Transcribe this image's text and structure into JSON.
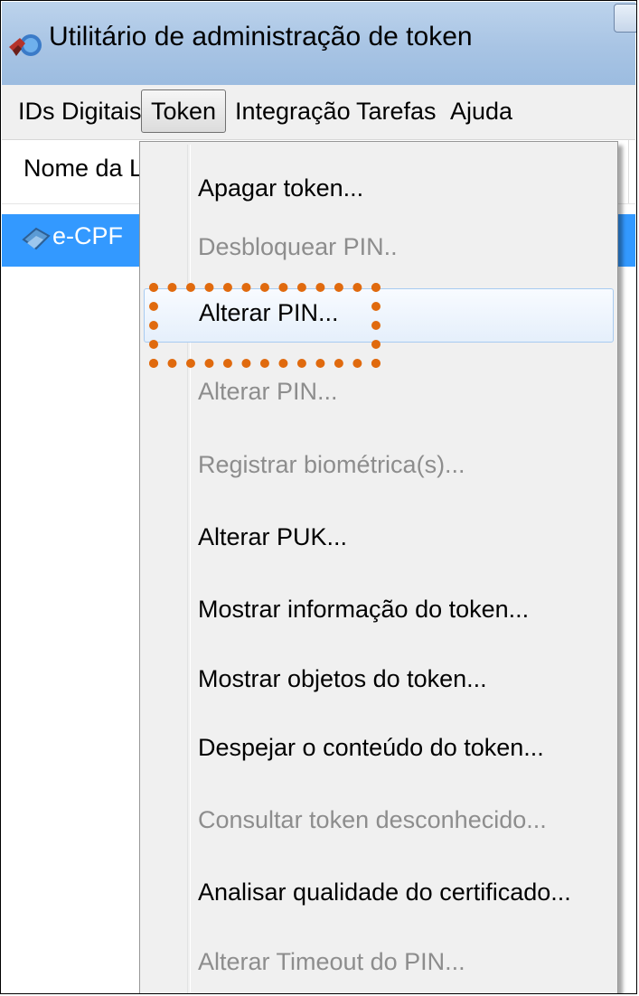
{
  "window": {
    "title": "Utilitário de administração de token",
    "app_icon": "token-app-icon"
  },
  "menubar": {
    "items": [
      {
        "label": "IDs Digitais"
      },
      {
        "label": "Token",
        "active": true
      },
      {
        "label": "Integração"
      },
      {
        "label": "Tarefas"
      },
      {
        "label": "Ajuda"
      }
    ]
  },
  "list": {
    "column_header": "Nome da Le",
    "rows": [
      {
        "label": "e-CPF",
        "icon": "token-device-icon",
        "selected": true
      }
    ]
  },
  "token_menu": {
    "items": [
      {
        "label": "Apagar token...",
        "enabled": true
      },
      {
        "label": "Desbloquear PIN..",
        "enabled": false
      },
      {
        "label": "Alterar PIN...",
        "enabled": true,
        "hovered": true
      },
      {
        "label": "Alterar PIN...",
        "enabled": false
      },
      {
        "label": "Registrar biométrica(s)...",
        "enabled": false
      },
      {
        "label": "Alterar PUK...",
        "enabled": true
      },
      {
        "label": "Mostrar informação do token...",
        "enabled": true
      },
      {
        "label": "Mostrar objetos do token...",
        "enabled": true
      },
      {
        "label": "Despejar o conteúdo do token...",
        "enabled": true
      },
      {
        "label": "Consultar token desconhecido...",
        "enabled": false
      },
      {
        "label": "Analisar qualidade do certificado...",
        "enabled": true
      },
      {
        "label": "Alterar Timeout do PIN...",
        "enabled": false
      }
    ]
  },
  "colors": {
    "selection": "#3399ff",
    "highlight_annotation": "#e06a0e",
    "disabled_text": "#8d8d8d"
  }
}
